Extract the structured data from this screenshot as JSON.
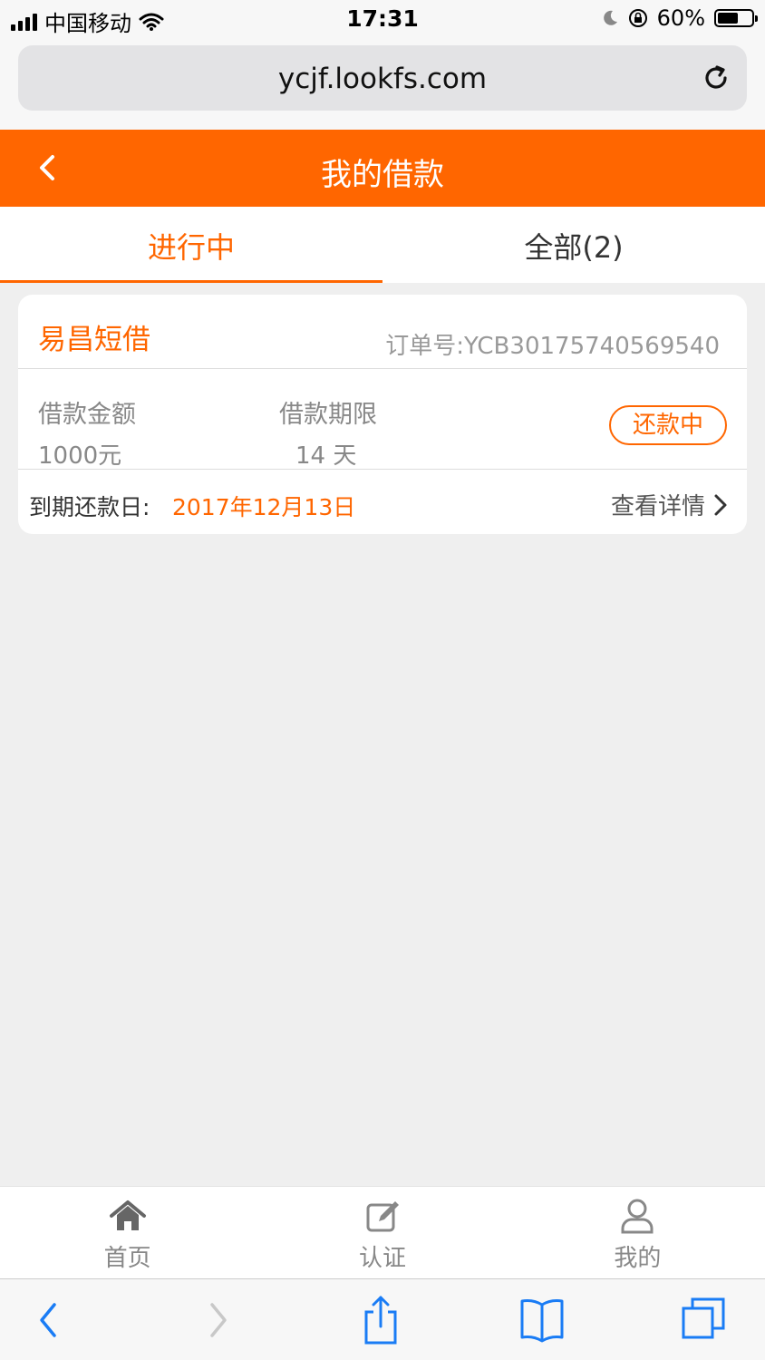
{
  "status_bar": {
    "carrier": "中国移动",
    "time": "17:31",
    "battery": "60%"
  },
  "browser": {
    "url": "ycjf.lookfs.com"
  },
  "header": {
    "title": "我的借款"
  },
  "tabs": [
    {
      "label": "进行中",
      "active": true
    },
    {
      "label": "全部(2)",
      "active": false
    }
  ],
  "loan": {
    "lender": "易昌短借",
    "order_no": "订单号:YCB30175740569540",
    "amount_label": "借款金额",
    "amount_value": "1000元",
    "term_label": "借款期限",
    "term_value": "14 天",
    "status": "还款中",
    "due_label": "到期还款日:",
    "due_value": "2017年12月13日",
    "detail_link": "查看详情"
  },
  "bottom_nav": [
    {
      "label": "首页",
      "icon": "home-icon"
    },
    {
      "label": "认证",
      "icon": "edit-icon"
    },
    {
      "label": "我的",
      "icon": "user-icon"
    }
  ],
  "colors": {
    "brand": "#ff6600",
    "background": "#efefef"
  }
}
